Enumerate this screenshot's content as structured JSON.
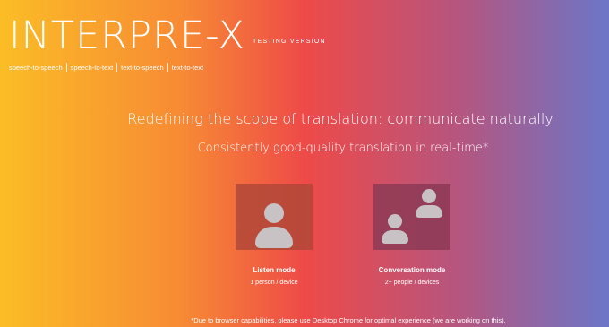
{
  "brand": {
    "title": "INTERPRE-X",
    "subtitle": "TESTING VERSION"
  },
  "nav": {
    "items": [
      {
        "label": "speech-to-speech"
      },
      {
        "label": "speech-to-text"
      },
      {
        "label": "text-to-speech"
      },
      {
        "label": "text-to-text"
      }
    ]
  },
  "hero": {
    "headline": "Redefining the scope of translation: communicate naturally",
    "subheadline": "Consistently good-quality translation in real-time*"
  },
  "modes": [
    {
      "label": "Listen mode",
      "description": "1 person / device",
      "icon": "person-icon"
    },
    {
      "label": "Conversation mode",
      "description": "2+ people / devices",
      "icon": "people-icon"
    }
  ],
  "footer": {
    "note": "*Due to browser capabilities, please use Desktop Chrome for optimal experience (we are working on this)."
  },
  "colors": {
    "gradient_left": "#fbbd26",
    "gradient_mid": "#ee4a48",
    "gradient_right": "#6b76c8",
    "icon_gray": "#c9c2c4"
  }
}
